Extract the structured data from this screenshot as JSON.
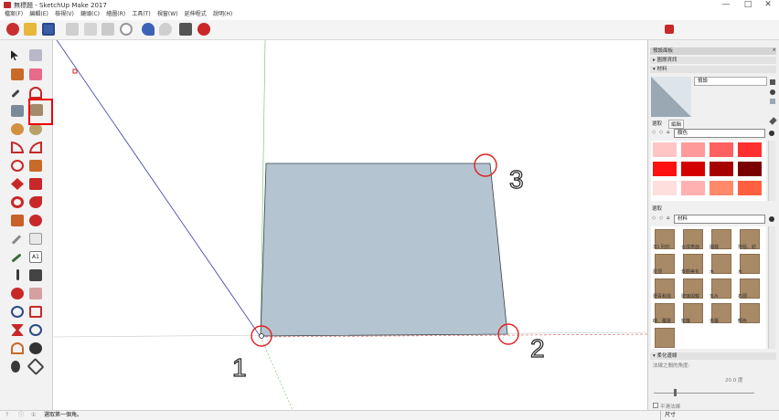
{
  "app": {
    "title": "無標題 - SketchUp Make 2017"
  },
  "window_controls": {
    "minimize": "—",
    "restore": "□",
    "close": "✕"
  },
  "menu": [
    "檔案(F)",
    "編輯(E)",
    "檢視(V)",
    "鏡頭(C)",
    "繪圖(R)",
    "工具(T)",
    "視窗(W)",
    "延伸程式",
    "說明(H)"
  ],
  "canvas": {
    "fill_color": "#b4c4d0",
    "markers": [
      "1",
      "2",
      "3"
    ]
  },
  "tray": {
    "title": "預設面板",
    "close": "×",
    "sections": {
      "entity_info": "▸ 圖層資訊",
      "materials": "▾ 材料",
      "soften_edges": "▾ 柔化邊線"
    },
    "material_name": "預設",
    "tabs": [
      "選取",
      "編輯"
    ],
    "color_dropdown": "顏色",
    "color_swatches": [
      "#ffc4c4",
      "#ff9a9a",
      "#ff6060",
      "#ff3030",
      "#ff1010",
      "#d40000",
      "#a80000",
      "#7a0000",
      "#ffdede",
      "#ffb0b0",
      "#ff8a6a",
      "#ff6040"
    ],
    "second_select_label": "選取",
    "material_dropdown": "材料",
    "material_items": [
      "3D 列印",
      "合成表面",
      "圖樣",
      "地毯、紡",
      "屋頂",
      "景觀美化",
      "木",
      "水",
      "瀝青和混",
      "玻璃與鏡",
      "瓦片",
      "石頭",
      "磚、覆層",
      "窗簾",
      "金屬",
      "顏色",
      ""
    ],
    "soften_label": "法線之間的角度:",
    "soften_value": "20.0 度",
    "soften_check": "平滑法線"
  },
  "status": {
    "icons": [
      "?",
      "ⓘ",
      "①"
    ],
    "text": "選取第一個角。",
    "measure_label": "尺寸"
  },
  "colors": {
    "accent_red": "#e02020"
  }
}
